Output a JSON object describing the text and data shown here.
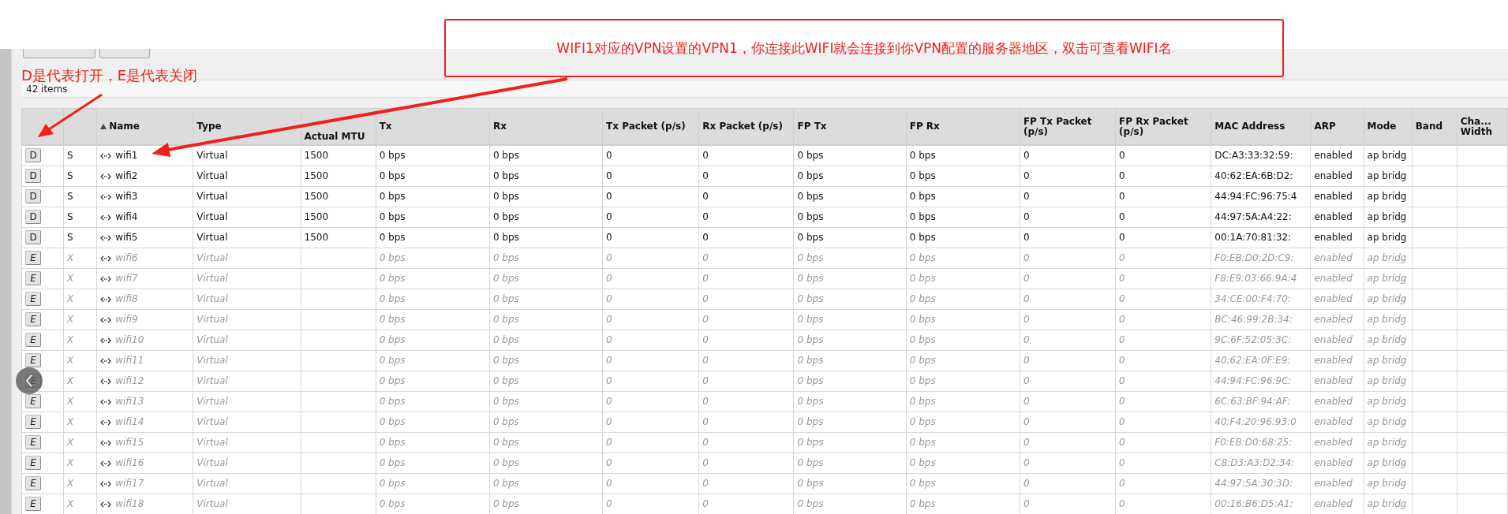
{
  "items_count": "42 items",
  "table": {
    "columns": [
      {
        "sorted": false
      },
      {
        "sorted": false
      },
      {
        "label": "Name",
        "sorted": true
      },
      {
        "label": "Type",
        "sorted": false
      },
      {
        "label": "Actual MTU",
        "sorted": false
      },
      {
        "label": "Tx",
        "sorted": false
      },
      {
        "label": "Rx",
        "sorted": false
      },
      {
        "label": "Tx Packet (p/s)",
        "sorted": false
      },
      {
        "label": "Rx Packet (p/s)",
        "sorted": false
      },
      {
        "label": "FP Tx",
        "sorted": false
      },
      {
        "label": "FP Rx",
        "sorted": false
      },
      {
        "label": "FP Tx Packet (p/s)",
        "sorted": false
      },
      {
        "label": "FP Rx Packet (p/s)",
        "sorted": false
      },
      {
        "label": "MAC Address",
        "sorted": false
      },
      {
        "label": "ARP",
        "sorted": false
      },
      {
        "label": "Mode",
        "sorted": false
      },
      {
        "label": "Band",
        "sorted": false
      },
      {
        "label": "Cha... Width",
        "sorted": false
      }
    ],
    "rows": [
      {
        "disabled": false,
        "cells": [
          "D",
          "S",
          "wifi1",
          "Virtual",
          "1500",
          "0 bps",
          "0 bps",
          "0",
          "0",
          "0 bps",
          "0 bps",
          "0",
          "0",
          "DC:A3:33:32:59:",
          "enabled",
          "ap bridg"
        ]
      },
      {
        "disabled": false,
        "cells": [
          "D",
          "S",
          "wifi2",
          "Virtual",
          "1500",
          "0 bps",
          "0 bps",
          "0",
          "0",
          "0 bps",
          "0 bps",
          "0",
          "0",
          "40:62:EA:6B:D2:",
          "enabled",
          "ap bridg"
        ]
      },
      {
        "disabled": false,
        "cells": [
          "D",
          "S",
          "wifi3",
          "Virtual",
          "1500",
          "0 bps",
          "0 bps",
          "0",
          "0",
          "0 bps",
          "0 bps",
          "0",
          "0",
          "44:94:FC:96:75:4",
          "enabled",
          "ap bridg"
        ]
      },
      {
        "disabled": false,
        "cells": [
          "D",
          "S",
          "wifi4",
          "Virtual",
          "1500",
          "0 bps",
          "0 bps",
          "0",
          "0",
          "0 bps",
          "0 bps",
          "0",
          "0",
          "44:97:5A:A4:22:",
          "enabled",
          "ap bridg"
        ]
      },
      {
        "disabled": false,
        "cells": [
          "D",
          "S",
          "wifi5",
          "Virtual",
          "1500",
          "0 bps",
          "0 bps",
          "0",
          "0",
          "0 bps",
          "0 bps",
          "0",
          "0",
          "00:1A:70:81:32:",
          "enabled",
          "ap bridg"
        ]
      },
      {
        "disabled": true,
        "cells": [
          "E",
          "X",
          "wifi6",
          "Virtual",
          "",
          "0 bps",
          "0 bps",
          "0",
          "0",
          "0 bps",
          "0 bps",
          "0",
          "0",
          "F0:EB:D0:2D:C9:",
          "enabled",
          "ap bridg"
        ]
      },
      {
        "disabled": true,
        "cells": [
          "E",
          "X",
          "wifi7",
          "Virtual",
          "",
          "0 bps",
          "0 bps",
          "0",
          "0",
          "0 bps",
          "0 bps",
          "0",
          "0",
          "F8:E9:03:66:9A:4",
          "enabled",
          "ap bridg"
        ]
      },
      {
        "disabled": true,
        "cells": [
          "E",
          "X",
          "wifi8",
          "Virtual",
          "",
          "0 bps",
          "0 bps",
          "0",
          "0",
          "0 bps",
          "0 bps",
          "0",
          "0",
          "34:CE:00:F4:70:",
          "enabled",
          "ap bridg"
        ]
      },
      {
        "disabled": true,
        "cells": [
          "E",
          "X",
          "wifi9",
          "Virtual",
          "",
          "0 bps",
          "0 bps",
          "0",
          "0",
          "0 bps",
          "0 bps",
          "0",
          "0",
          "BC:46:99:2B:34:",
          "enabled",
          "ap bridg"
        ]
      },
      {
        "disabled": true,
        "cells": [
          "E",
          "X",
          "wifi10",
          "Virtual",
          "",
          "0 bps",
          "0 bps",
          "0",
          "0",
          "0 bps",
          "0 bps",
          "0",
          "0",
          "9C:6F:52:05:3C:",
          "enabled",
          "ap bridg"
        ]
      },
      {
        "disabled": true,
        "cells": [
          "E",
          "X",
          "wifi11",
          "Virtual",
          "",
          "0 bps",
          "0 bps",
          "0",
          "0",
          "0 bps",
          "0 bps",
          "0",
          "0",
          "40:62:EA:0F:E9:",
          "enabled",
          "ap bridg"
        ]
      },
      {
        "disabled": true,
        "cells": [
          "E",
          "X",
          "wifi12",
          "Virtual",
          "",
          "0 bps",
          "0 bps",
          "0",
          "0",
          "0 bps",
          "0 bps",
          "0",
          "0",
          "44:94:FC:96:9C:",
          "enabled",
          "ap bridg"
        ]
      },
      {
        "disabled": true,
        "cells": [
          "E",
          "X",
          "wifi13",
          "Virtual",
          "",
          "0 bps",
          "0 bps",
          "0",
          "0",
          "0 bps",
          "0 bps",
          "0",
          "0",
          "6C:63:BF:94:AF:",
          "enabled",
          "ap bridg"
        ]
      },
      {
        "disabled": true,
        "cells": [
          "E",
          "X",
          "wifi14",
          "Virtual",
          "",
          "0 bps",
          "0 bps",
          "0",
          "0",
          "0 bps",
          "0 bps",
          "0",
          "0",
          "40:F4:20:96:93:0",
          "enabled",
          "ap bridg"
        ]
      },
      {
        "disabled": true,
        "cells": [
          "E",
          "X",
          "wifi15",
          "Virtual",
          "",
          "0 bps",
          "0 bps",
          "0",
          "0",
          "0 bps",
          "0 bps",
          "0",
          "0",
          "F0:EB:D0:68:25:",
          "enabled",
          "ap bridg"
        ]
      },
      {
        "disabled": true,
        "cells": [
          "E",
          "X",
          "wifi16",
          "Virtual",
          "",
          "0 bps",
          "0 bps",
          "0",
          "0",
          "0 bps",
          "0 bps",
          "0",
          "0",
          "C8:D3:A3:D2:34:",
          "enabled",
          "ap bridg"
        ]
      },
      {
        "disabled": true,
        "cells": [
          "E",
          "X",
          "wifi17",
          "Virtual",
          "",
          "0 bps",
          "0 bps",
          "0",
          "0",
          "0 bps",
          "0 bps",
          "0",
          "0",
          "44:97:5A:30:3D:",
          "enabled",
          "ap bridg"
        ]
      },
      {
        "disabled": true,
        "cells": [
          "E",
          "X",
          "wifi18",
          "Virtual",
          "",
          "0 bps",
          "0 bps",
          "0",
          "0",
          "0 bps",
          "0 bps",
          "0",
          "0",
          "00:16:B6:D5:A1:",
          "enabled",
          "ap bridg"
        ]
      }
    ]
  },
  "annotations": [
    {
      "kind": "box",
      "text": "WIFI1对应的VPN设置的VPN1，你连接此WIFI就会连接到你VPN配置的服务器地区，双击可查看WIFI名"
    },
    {
      "kind": "label",
      "text": "D是代表打开，E是代表关闭"
    }
  ]
}
